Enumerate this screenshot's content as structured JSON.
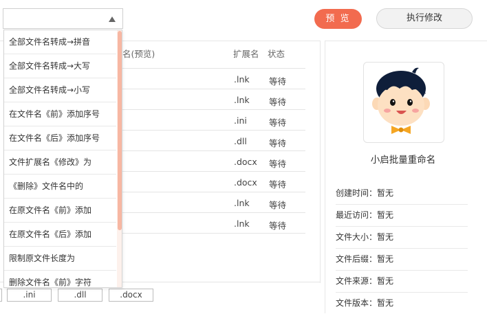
{
  "toolbar": {
    "combo_value": "",
    "preview_label": "预 览",
    "execute_label": "执行修改"
  },
  "table": {
    "headers": {
      "name_preview": "名(预览)",
      "extension": "扩展名",
      "status": "状态"
    },
    "rows": [
      {
        "ext": ".lnk",
        "status": "等待"
      },
      {
        "ext": ".lnk",
        "status": "等待"
      },
      {
        "ext": ".ini",
        "status": "等待"
      },
      {
        "ext": ".dll",
        "status": "等待"
      },
      {
        "ext": ".docx",
        "status": "等待"
      },
      {
        "ext": ".docx",
        "status": "等待"
      },
      {
        "ext": ".lnk",
        "status": "等待"
      },
      {
        "ext": ".lnk",
        "status": "等待"
      }
    ]
  },
  "ext_tags": [
    ".ini",
    ".dll",
    ".docx"
  ],
  "dropdown": {
    "items": [
      "全部文件名转成→拼音",
      "全部文件名转成→大写",
      "全部文件名转成→小写",
      "在文件名《前》添加序号",
      "在文件名《后》添加序号",
      "文件扩展名《修改》为",
      "《删除》文件名中的",
      "在原文件名《前》添加",
      "在原文件名《后》添加",
      "限制原文件长度为",
      "删除文件名《前》字符"
    ]
  },
  "info": {
    "app_name": "小启批量重命名",
    "rows": [
      "创建时间：暂无",
      "最近访问：暂无",
      "文件大小：暂无",
      "文件后缀：暂无",
      "文件来源：暂无",
      "文件版本：暂无"
    ]
  },
  "colors": {
    "accent": "#f26b4f",
    "scrollbar": "#f7b7a3"
  }
}
